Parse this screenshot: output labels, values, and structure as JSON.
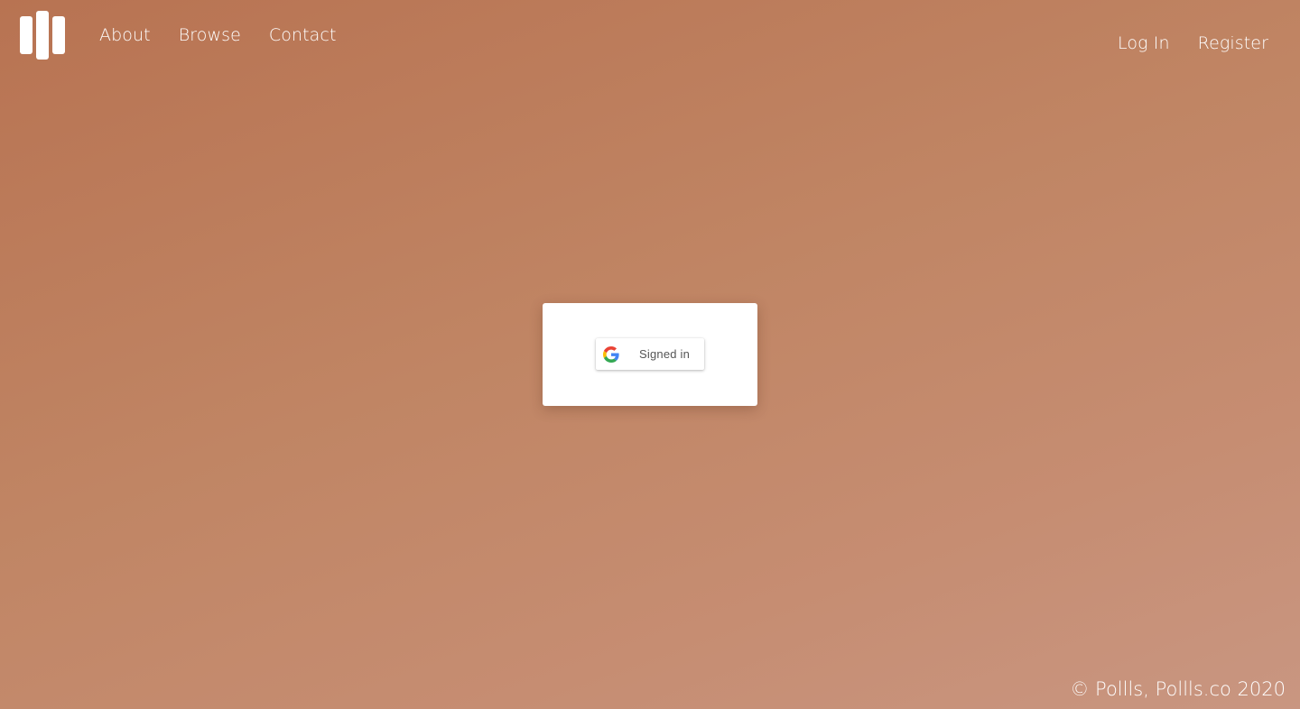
{
  "nav": {
    "left": [
      {
        "label": "About"
      },
      {
        "label": "Browse"
      },
      {
        "label": "Contact"
      }
    ],
    "right": [
      {
        "label": "Log In"
      },
      {
        "label": "Register"
      }
    ]
  },
  "logo": {
    "icon": "bars-logo-icon"
  },
  "signin_card": {
    "button_label": "Signed in",
    "icon": "google-g-icon"
  },
  "footer": {
    "text": "© Pollls, Pollls.co 2020"
  },
  "colors": {
    "background_start": "#b87352",
    "background_end": "#c99681",
    "text": "#ffffff",
    "card": "#ffffff"
  }
}
